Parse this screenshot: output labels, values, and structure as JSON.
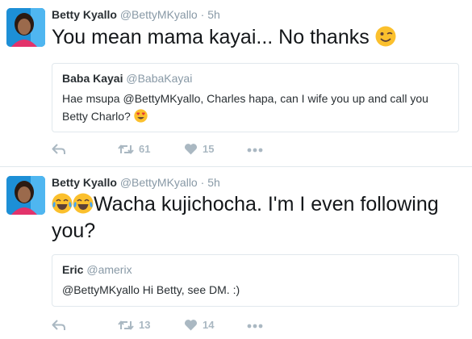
{
  "tweets": [
    {
      "author_name": "Betty Kyallo",
      "author_handle": "@BettyMKyallo",
      "dot": "·",
      "time": "5h",
      "text": "You mean mama kayai... No thanks",
      "text_emoji": "winking-face",
      "quote": {
        "name": "Baba Kayai",
        "handle": "@BabaKayai",
        "text": "Hae msupa @BettyMKyallo, Charles hapa, can I wife you up and call you Betty Charlo?",
        "text_emoji": "heart-eyes-face"
      },
      "actions": {
        "retweets": "61",
        "likes": "15"
      }
    },
    {
      "author_name": "Betty Kyallo",
      "author_handle": "@BettyMKyallo",
      "dot": "·",
      "time": "5h",
      "text": "Wacha kujichocha. I'm I even following you?",
      "text_emoji": "tears-of-joy-face",
      "quote": {
        "name": "Eric",
        "handle": "@amerix",
        "text": "@BettyMKyallo Hi Betty, see DM. :)"
      },
      "actions": {
        "retweets": "13",
        "likes": "14"
      }
    }
  ],
  "colors": {
    "name": "#292f33",
    "meta": "#8899a6",
    "border": "#e1e8ed",
    "action": "#aab8c2",
    "avatar_bg": "#1d8fd6"
  }
}
